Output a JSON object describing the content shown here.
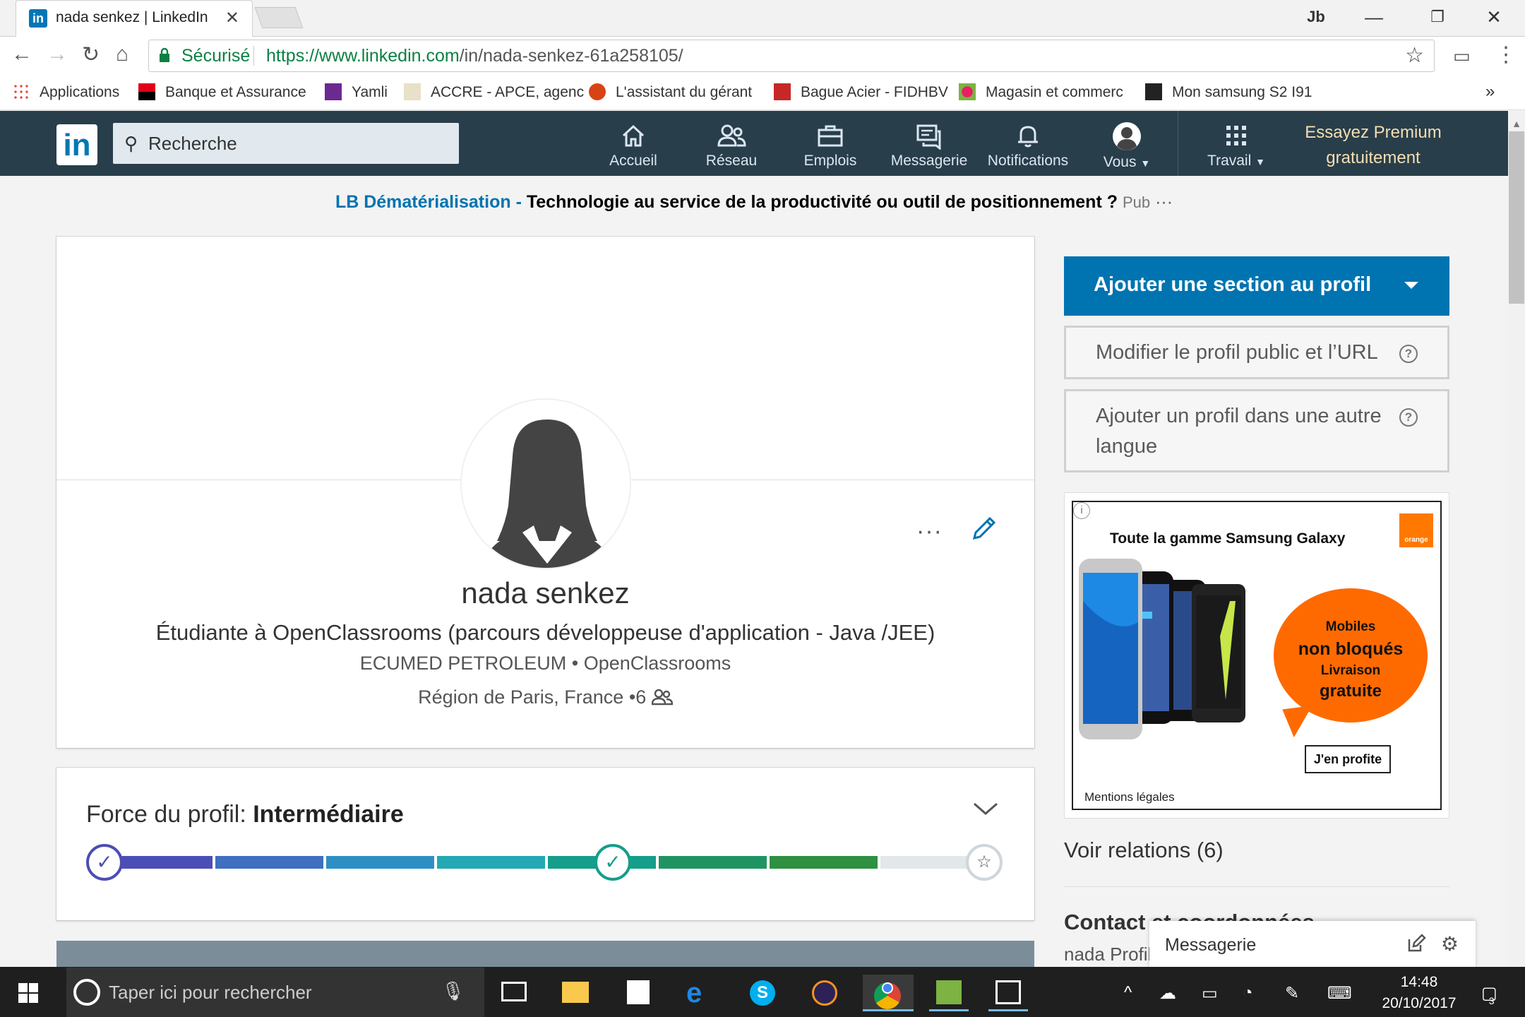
{
  "browser": {
    "tab_title": "nada senkez | LinkedIn",
    "tab_favicon": "in",
    "security_label": "Sécurisé",
    "url_base": "https://www.linkedin.com",
    "url_path": "/in/nada-senkez-61a258105/",
    "profile_badge": "Jb",
    "bookmarks": [
      {
        "label": "Applications",
        "icon": "apps-grid-icon"
      },
      {
        "label": "Banque et Assurance",
        "icon": "bank-icon"
      },
      {
        "label": "Yamli",
        "icon": "yamli-icon"
      },
      {
        "label": "ACCRE - APCE, agenc",
        "icon": "apce-icon"
      },
      {
        "label": "L'assistant du gérant",
        "icon": "g-icon"
      },
      {
        "label": "Bague Acier - FIDHBV",
        "icon": "hdo-icon"
      },
      {
        "label": "Magasin et commerc",
        "icon": "shop-icon"
      },
      {
        "label": "Mon samsung S2 I91",
        "icon": "f-icon"
      }
    ],
    "bookmarks_overflow": "»"
  },
  "linkedin": {
    "logo": "in",
    "search_placeholder": "Recherche",
    "nav": [
      {
        "label": "Accueil",
        "icon": "home-icon"
      },
      {
        "label": "Réseau",
        "icon": "network-icon"
      },
      {
        "label": "Emplois",
        "icon": "briefcase-icon"
      },
      {
        "label": "Messagerie",
        "icon": "messaging-icon"
      },
      {
        "label": "Notifications",
        "icon": "bell-icon"
      },
      {
        "label": "Vous",
        "icon": "avatar-icon"
      }
    ],
    "work_label": "Travail",
    "premium_line1": "Essayez Premium",
    "premium_line2": "gratuitement",
    "brand_color": "#0073b1",
    "header_color": "#283e4a"
  },
  "ad_line": {
    "company": "LB Dématérialisation -",
    "text": "Technologie au service de la productivité ou outil de positionnement ?",
    "pub": "Pub",
    "more": "···"
  },
  "profile": {
    "name": "nada senkez",
    "headline": "Étudiante à OpenClassrooms (parcours développeuse d'application - Java /JEE)",
    "companies": "ECUMED PETROLEUM • OpenClassrooms",
    "location": "Région de Paris, France",
    "connections_prefix": "•6",
    "more_dots": "···"
  },
  "strength": {
    "label": "Force du profil: ",
    "level": "Intermédiaire",
    "segment_colors": [
      "#4b4eb4",
      "#3e6fc0",
      "#2e8fc4",
      "#23a8b4",
      "#159e8a",
      "#1f9462",
      "#2e9040",
      "#e2e7ea"
    ],
    "steps_completed": 2,
    "steps_total": 3
  },
  "rail": {
    "add_section": "Ajouter une section au profil",
    "edit_public": "Modifier le profil public et l’URL",
    "add_language_l1": "Ajouter un profil dans une autre",
    "add_language_l2": "langue",
    "help_glyph": "?",
    "relations": "Voir relations (6)",
    "contact": "Contact et coordonnées",
    "contact_sub": "nada Profil"
  },
  "ad": {
    "info": "i",
    "title": "Toute la gamme Samsung Galaxy",
    "brand": "orange",
    "bubble_l1": "Mobiles",
    "bubble_l2": "non bloqués",
    "bubble_l3": "Livraison",
    "bubble_l4": "gratuite",
    "cta": "J'en profite",
    "legal": "Mentions légales",
    "brand_color": "#ff7900"
  },
  "messaging": {
    "label": "Messagerie"
  },
  "taskbar": {
    "search_placeholder": "Taper ici pour rechercher",
    "time": "14:48",
    "date": "20/10/2017",
    "notif_count": "3"
  }
}
